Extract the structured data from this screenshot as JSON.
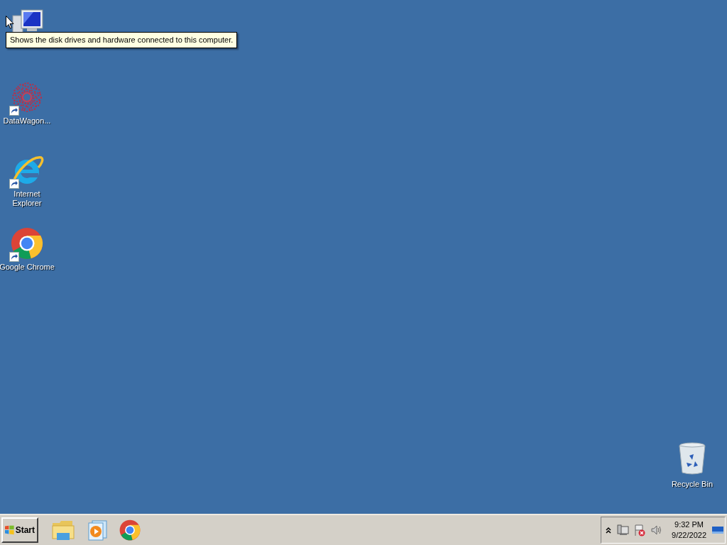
{
  "desktop": {
    "icons": [
      {
        "kind": "computer"
      },
      {
        "kind": "flower",
        "label": "DataWagon...",
        "shortcut": true
      },
      {
        "kind": "ie",
        "label": "Internet Explorer",
        "shortcut": true
      },
      {
        "kind": "chrome",
        "label": "Google Chrome",
        "shortcut": true
      }
    ],
    "recycle_bin": {
      "label": "Recycle Bin"
    }
  },
  "tooltip": {
    "text": "Shows the disk drives and hardware connected to this computer."
  },
  "taskbar": {
    "start": "Start",
    "pinned": [
      {
        "kind": "folder"
      },
      {
        "kind": "media"
      },
      {
        "kind": "chrome"
      }
    ],
    "tray": {
      "time": "9:32 PM",
      "date": "9/22/2022"
    }
  }
}
